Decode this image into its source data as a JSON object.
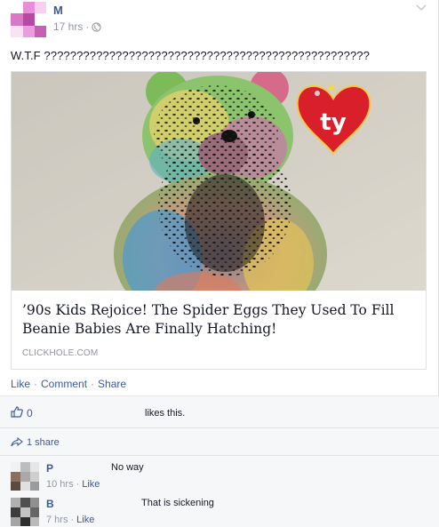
{
  "post": {
    "author": "M",
    "time": "17 hrs",
    "separator": "·",
    "status": "W.T.F ??????????????????????????????????????????????????"
  },
  "link": {
    "title": "’90s Kids Rejoice! The Spider Eggs They Used To Fill Beanie Babies Are Finally Hatching!",
    "source": "CLICKHOLE.COM",
    "image_tag_text": "ty"
  },
  "actions": {
    "like": "Like",
    "comment": "Comment",
    "share": "Share",
    "dot": "·"
  },
  "feedback": {
    "like_count": "0",
    "likes_text": "likes this.",
    "share_count": "1 share"
  },
  "comments": [
    {
      "name": "P",
      "text": "No way",
      "time": "10 hrs",
      "like": "Like"
    },
    {
      "name": "B",
      "text": "That is sickening",
      "time": "7 hrs",
      "like": "Like"
    }
  ],
  "colors": {
    "link_blue": "#3b5998",
    "meta_gray": "#9197a3",
    "ufi_bg": "#f6f7f9"
  },
  "icons": [
    "globe-icon",
    "chevron-down-icon",
    "thumbs-up-icon",
    "share-arrow-icon"
  ]
}
